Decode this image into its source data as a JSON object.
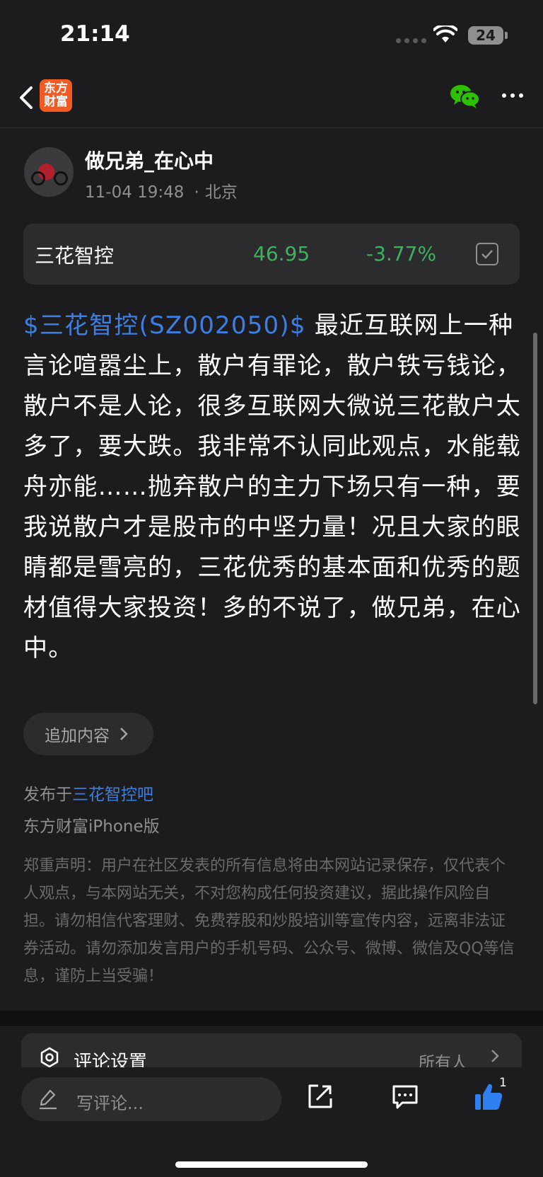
{
  "status": {
    "time": "21:14",
    "battery": "24"
  },
  "nav": {
    "logo_line1": "东方",
    "logo_line2": "财富"
  },
  "author": {
    "name": "做兄弟_在心中",
    "date": "11-04 19:48",
    "location": "北京"
  },
  "stock": {
    "name": "三花智控",
    "price": "46.95",
    "change": "-3.77%"
  },
  "post": {
    "stock_tag": "$三花智控(SZ002050)$",
    "text": "最近互联网上一种言论喧嚣尘上，散户有罪论，散户铁亏钱论，散户不是人论，很多互联网大微说三花散户太多了，要大跌。我非常不认同此观点，水能载舟亦能……抛弃散户的主力下场只有一种，要我说散户才是股市的中坚力量！况且大家的眼睛都是雪亮的，三花优秀的基本面和优秀的题材值得大家投资！多的不说了，做兄弟，在心中。"
  },
  "append_label": "追加内容",
  "published": {
    "prefix": "发布于",
    "forum": "三花智控吧",
    "client": "东方财富iPhone版"
  },
  "disclaimer": "郑重声明：用户在社区发表的所有信息将由本网站记录保存，仅代表个人观点，与本网站无关，不对您构成任何投资建议，据此操作风险自担。请勿相信代客理财、免费荐股和炒股培训等宣传内容，远离非法证券活动。请勿添加发言用户的手机号码、公众号、微博、微信及QQ等信息，谨防上当受骗！",
  "comment_settings": {
    "label": "评论设置",
    "value": "所有人"
  },
  "bottom": {
    "input_placeholder": "写评论...",
    "like_count": "1"
  },
  "colors": {
    "accent_blue": "#3d7ee0",
    "down_green": "#3fb060",
    "logo_orange": "#f15a22",
    "like_blue": "#2f7ff0"
  }
}
